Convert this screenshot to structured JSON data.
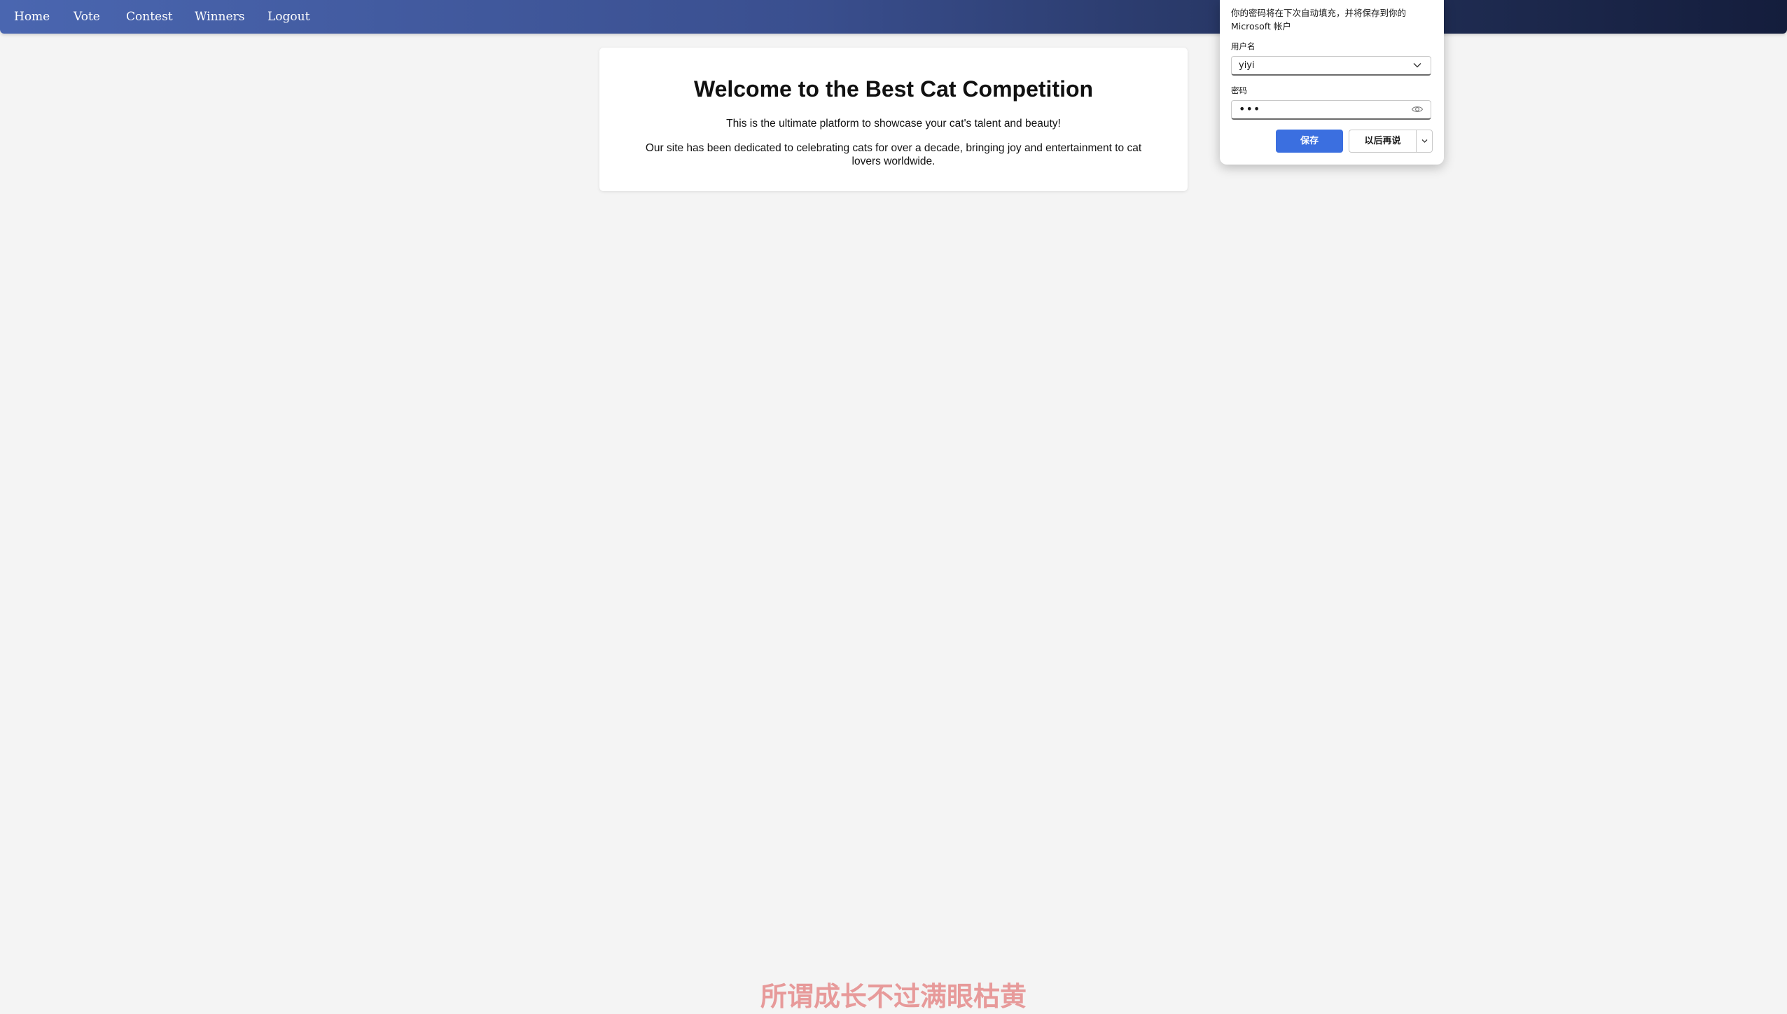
{
  "nav": {
    "items": [
      {
        "label": "Home"
      },
      {
        "label": "Vote"
      },
      {
        "label": "Contest"
      },
      {
        "label": "Winners"
      },
      {
        "label": "Logout"
      }
    ]
  },
  "main": {
    "title": "Welcome to the Best Cat Competition",
    "paragraph1": "This is the ultimate platform to showcase your cat's talent and beauty!",
    "paragraph2": "Our site has been dedicated to celebrating cats for over a decade, bringing joy and entertainment to cat lovers worldwide."
  },
  "password_popup": {
    "message": "你的密码将在下次自动填充，并将保存到你的 Microsoft 帐户",
    "username_label": "用户名",
    "username_value": "yiyi",
    "password_label": "密码",
    "password_masked": "•••",
    "save_label": "保存",
    "later_label": "以后再说"
  },
  "caption": {
    "text": "所谓成长不过满眼枯黄"
  },
  "colors": {
    "nav_gradient_start": "#4a66b0",
    "nav_gradient_end": "#141d3c",
    "save_button": "#3b6fe0",
    "caption": "#e79a9a",
    "page_background": "#f4f4f4"
  }
}
